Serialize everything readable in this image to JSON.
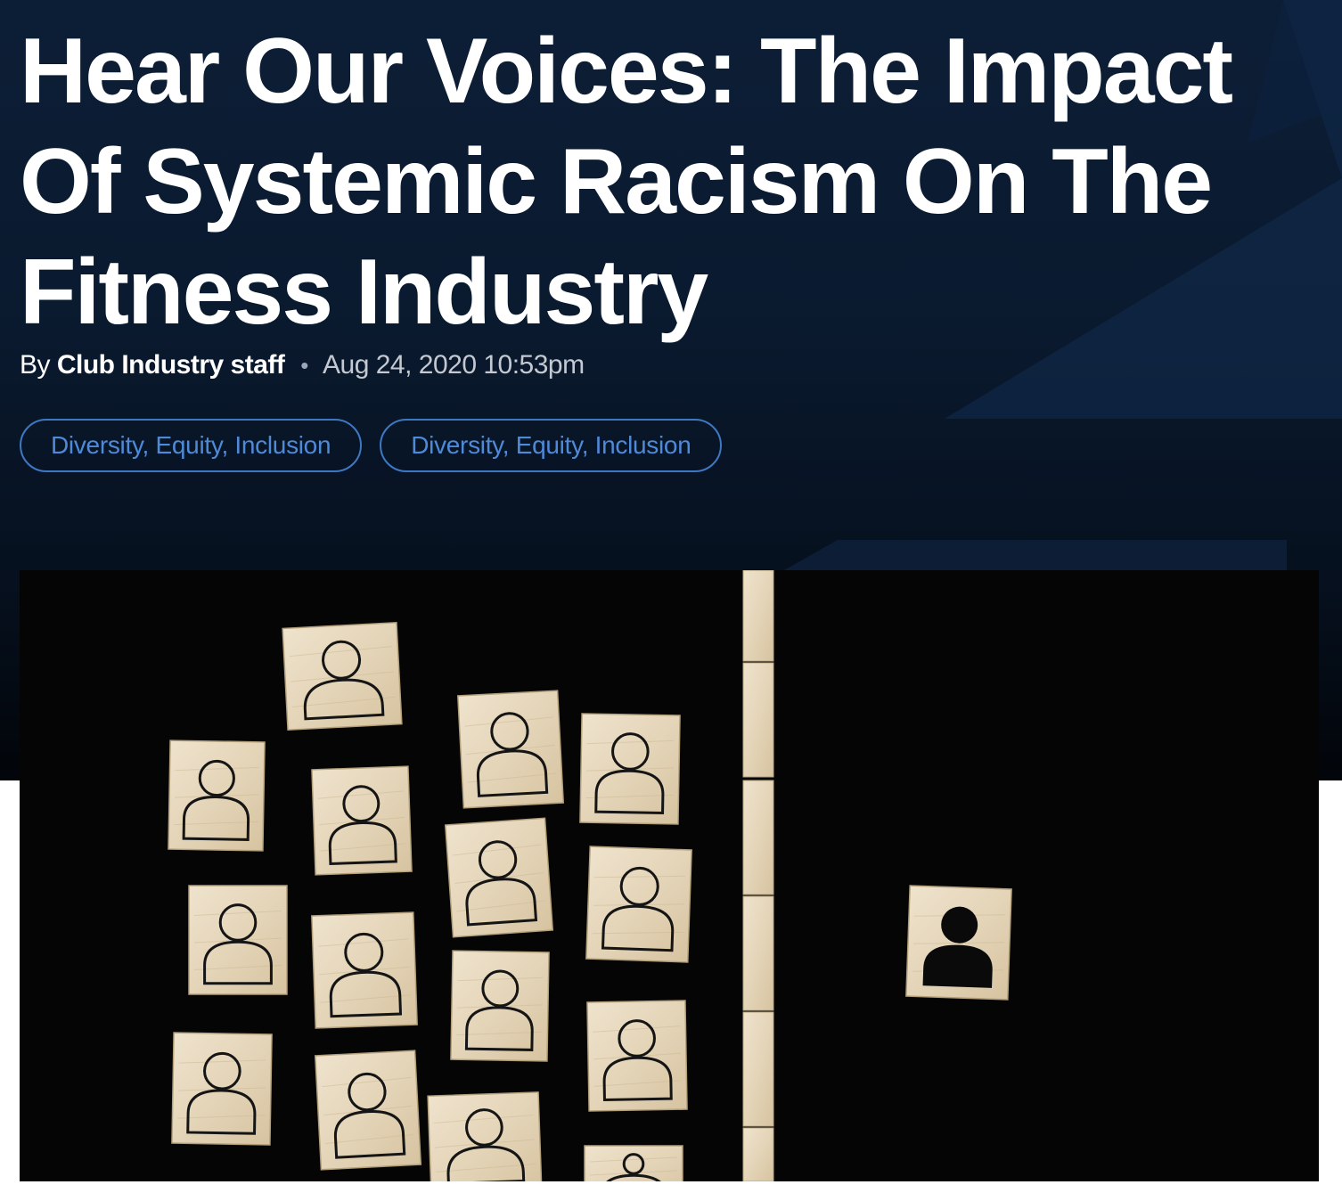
{
  "article": {
    "title": "Hear Our Voices: The Impact Of Systemic Racism On The Fitness Industry",
    "byline": {
      "prefix": "By",
      "author": "Club Industry staff",
      "separator": "•",
      "date": "Aug 24, 2020 10:53pm"
    },
    "tags": [
      {
        "label": "Diversity, Equity, Inclusion"
      },
      {
        "label": "Diversity, Equity, Inclusion"
      }
    ]
  },
  "theme": {
    "hero_background": "#0a1a2f",
    "tag_border": "#3f78c2",
    "tag_text": "#4f8ad8",
    "block_wood": "#e8dac1",
    "image_background": "#050505"
  },
  "featured_image": {
    "icon_name": "person-blocks-illustration"
  }
}
